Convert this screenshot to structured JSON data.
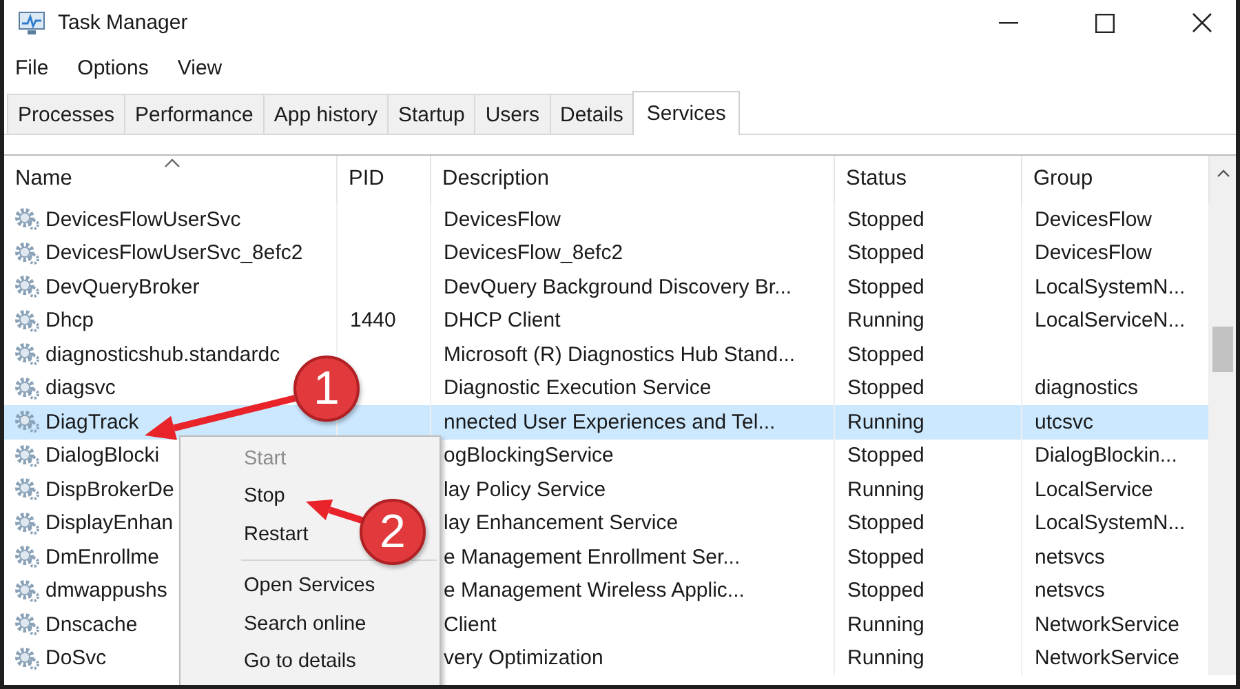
{
  "window": {
    "title": "Task Manager"
  },
  "menu": [
    "File",
    "Options",
    "View"
  ],
  "tabs": [
    {
      "label": "Processes",
      "selected": false
    },
    {
      "label": "Performance",
      "selected": false
    },
    {
      "label": "App history",
      "selected": false
    },
    {
      "label": "Startup",
      "selected": false
    },
    {
      "label": "Users",
      "selected": false
    },
    {
      "label": "Details",
      "selected": false
    },
    {
      "label": "Services",
      "selected": true
    }
  ],
  "table": {
    "columns": [
      {
        "label": "Name",
        "sort_caret": true
      },
      {
        "label": "PID"
      },
      {
        "label": "Description"
      },
      {
        "label": "Status"
      },
      {
        "label": "Group"
      }
    ],
    "rows": [
      {
        "name": "DevicesFlowUserSvc",
        "description": "DevicesFlow",
        "status": "Stopped",
        "group": "DevicesFlow",
        "selected": false
      },
      {
        "name": "DevicesFlowUserSvc_8efc2",
        "description": "DevicesFlow_8efc2",
        "status": "Stopped",
        "group": "DevicesFlow",
        "selected": false
      },
      {
        "name": "DevQueryBroker",
        "description": "DevQuery Background Discovery Br...",
        "status": "Stopped",
        "group": "LocalSystemN...",
        "selected": false
      },
      {
        "name": "Dhcp",
        "pid": "1440",
        "description": "DHCP Client",
        "status": "Running",
        "group": "LocalServiceN...",
        "selected": false
      },
      {
        "name": "diagnosticshub.standardc",
        "description": "Microsoft (R) Diagnostics Hub Stand...",
        "status": "Stopped",
        "selected": false
      },
      {
        "name": "diagsvc",
        "description": "Diagnostic Execution Service",
        "status": "Stopped",
        "group": "diagnostics",
        "selected": false
      },
      {
        "name": "DiagTrack",
        "description": "nnected User Experiences and Tel...",
        "status": "Running",
        "group": "utcsvc",
        "selected": true
      },
      {
        "name": "DialogBlocki",
        "description": "ogBlockingService",
        "status": "Stopped",
        "group": "DialogBlockin...",
        "selected": false
      },
      {
        "name": "DispBrokerDe",
        "description": "lay Policy Service",
        "status": "Running",
        "group": "LocalService",
        "selected": false
      },
      {
        "name": "DisplayEnhan",
        "description": "lay Enhancement Service",
        "status": "Stopped",
        "group": "LocalSystemN...",
        "selected": false
      },
      {
        "name": "DmEnrollme",
        "description": "e Management Enrollment Ser...",
        "status": "Stopped",
        "group": "netsvcs",
        "selected": false
      },
      {
        "name": "dmwappushs",
        "description": "e Management Wireless Applic...",
        "status": "Stopped",
        "group": "netsvcs",
        "selected": false
      },
      {
        "name": "Dnscache",
        "description": "Client",
        "status": "Running",
        "group": "NetworkService",
        "selected": false
      },
      {
        "name": "DoSvc",
        "description": "very Optimization",
        "status": "Running",
        "group": "NetworkService",
        "selected": false
      }
    ]
  },
  "context_menu": {
    "groups": [
      [
        {
          "label": "Start",
          "disabled": true
        },
        {
          "label": "Stop",
          "disabled": false
        },
        {
          "label": "Restart",
          "disabled": false
        }
      ],
      [
        {
          "label": "Open Services",
          "disabled": false
        },
        {
          "label": "Search online",
          "disabled": false
        },
        {
          "label": "Go to details",
          "disabled": false
        }
      ]
    ]
  },
  "callouts": [
    {
      "number": "1"
    },
    {
      "number": "2"
    }
  ]
}
